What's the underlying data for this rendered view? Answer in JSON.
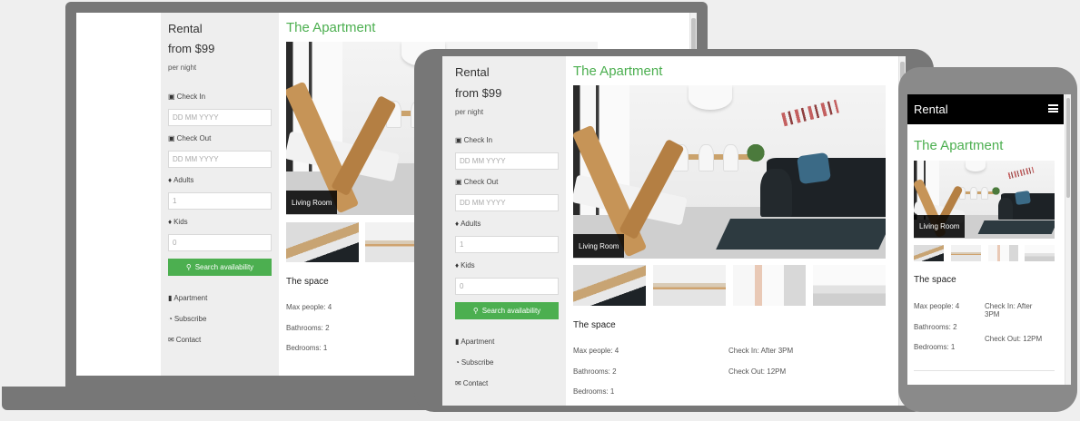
{
  "brand": "Rental",
  "price": "from $99",
  "price_unit": "per night",
  "title": "The Apartment",
  "form": {
    "check_in_label": "Check In",
    "check_in_placeholder": "DD MM YYYY",
    "check_out_label": "Check Out",
    "check_out_placeholder": "DD MM YYYY",
    "adults_label": "Adults",
    "adults_value": "1",
    "kids_label": "Kids",
    "kids_value": "0",
    "search_label": "Search availability"
  },
  "nav": {
    "apartment": "Apartment",
    "subscribe": "Subscribe",
    "contact": "Contact"
  },
  "gallery": {
    "caption": "Living Room"
  },
  "space": {
    "heading": "The space",
    "max_people": "Max people: 4",
    "bathrooms": "Bathrooms: 2",
    "bedrooms": "Bedrooms: 1",
    "check_in": "Check In: After 3PM",
    "check_in_line1": "Check In: After",
    "check_in_line2": "3PM",
    "check_out": "Check Out: 12PM"
  },
  "icons": {
    "calendar": "calendar-icon",
    "adult": "male-icon",
    "child": "child-icon",
    "search": "search-icon",
    "building": "building-icon",
    "rss": "rss-icon",
    "envelope": "envelope-icon",
    "menu": "hamburger-menu-icon"
  },
  "colors": {
    "accent": "#4caf50",
    "sidebar": "#eeeeee",
    "device": "#777777",
    "phone_header": "#000000"
  }
}
